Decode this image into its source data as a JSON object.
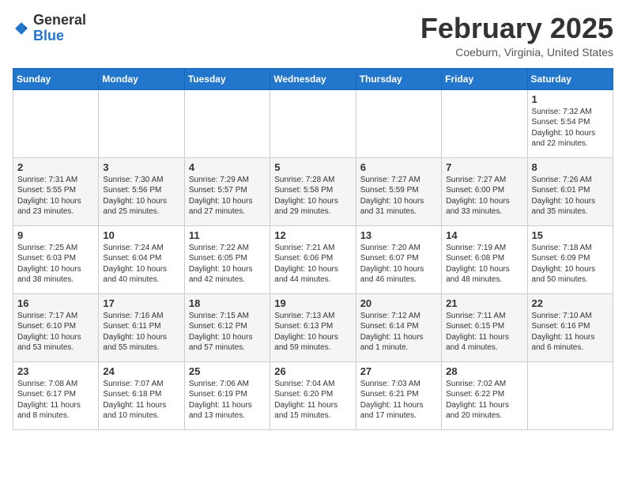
{
  "header": {
    "logo_general": "General",
    "logo_blue": "Blue",
    "title": "February 2025",
    "subtitle": "Coeburn, Virginia, United States"
  },
  "days_of_week": [
    "Sunday",
    "Monday",
    "Tuesday",
    "Wednesday",
    "Thursday",
    "Friday",
    "Saturday"
  ],
  "weeks": [
    [
      {
        "day": "",
        "info": ""
      },
      {
        "day": "",
        "info": ""
      },
      {
        "day": "",
        "info": ""
      },
      {
        "day": "",
        "info": ""
      },
      {
        "day": "",
        "info": ""
      },
      {
        "day": "",
        "info": ""
      },
      {
        "day": "1",
        "info": "Sunrise: 7:32 AM\nSunset: 5:54 PM\nDaylight: 10 hours and 22 minutes."
      }
    ],
    [
      {
        "day": "2",
        "info": "Sunrise: 7:31 AM\nSunset: 5:55 PM\nDaylight: 10 hours and 23 minutes."
      },
      {
        "day": "3",
        "info": "Sunrise: 7:30 AM\nSunset: 5:56 PM\nDaylight: 10 hours and 25 minutes."
      },
      {
        "day": "4",
        "info": "Sunrise: 7:29 AM\nSunset: 5:57 PM\nDaylight: 10 hours and 27 minutes."
      },
      {
        "day": "5",
        "info": "Sunrise: 7:28 AM\nSunset: 5:58 PM\nDaylight: 10 hours and 29 minutes."
      },
      {
        "day": "6",
        "info": "Sunrise: 7:27 AM\nSunset: 5:59 PM\nDaylight: 10 hours and 31 minutes."
      },
      {
        "day": "7",
        "info": "Sunrise: 7:27 AM\nSunset: 6:00 PM\nDaylight: 10 hours and 33 minutes."
      },
      {
        "day": "8",
        "info": "Sunrise: 7:26 AM\nSunset: 6:01 PM\nDaylight: 10 hours and 35 minutes."
      }
    ],
    [
      {
        "day": "9",
        "info": "Sunrise: 7:25 AM\nSunset: 6:03 PM\nDaylight: 10 hours and 38 minutes."
      },
      {
        "day": "10",
        "info": "Sunrise: 7:24 AM\nSunset: 6:04 PM\nDaylight: 10 hours and 40 minutes."
      },
      {
        "day": "11",
        "info": "Sunrise: 7:22 AM\nSunset: 6:05 PM\nDaylight: 10 hours and 42 minutes."
      },
      {
        "day": "12",
        "info": "Sunrise: 7:21 AM\nSunset: 6:06 PM\nDaylight: 10 hours and 44 minutes."
      },
      {
        "day": "13",
        "info": "Sunrise: 7:20 AM\nSunset: 6:07 PM\nDaylight: 10 hours and 46 minutes."
      },
      {
        "day": "14",
        "info": "Sunrise: 7:19 AM\nSunset: 6:08 PM\nDaylight: 10 hours and 48 minutes."
      },
      {
        "day": "15",
        "info": "Sunrise: 7:18 AM\nSunset: 6:09 PM\nDaylight: 10 hours and 50 minutes."
      }
    ],
    [
      {
        "day": "16",
        "info": "Sunrise: 7:17 AM\nSunset: 6:10 PM\nDaylight: 10 hours and 53 minutes."
      },
      {
        "day": "17",
        "info": "Sunrise: 7:16 AM\nSunset: 6:11 PM\nDaylight: 10 hours and 55 minutes."
      },
      {
        "day": "18",
        "info": "Sunrise: 7:15 AM\nSunset: 6:12 PM\nDaylight: 10 hours and 57 minutes."
      },
      {
        "day": "19",
        "info": "Sunrise: 7:13 AM\nSunset: 6:13 PM\nDaylight: 10 hours and 59 minutes."
      },
      {
        "day": "20",
        "info": "Sunrise: 7:12 AM\nSunset: 6:14 PM\nDaylight: 11 hours and 1 minute."
      },
      {
        "day": "21",
        "info": "Sunrise: 7:11 AM\nSunset: 6:15 PM\nDaylight: 11 hours and 4 minutes."
      },
      {
        "day": "22",
        "info": "Sunrise: 7:10 AM\nSunset: 6:16 PM\nDaylight: 11 hours and 6 minutes."
      }
    ],
    [
      {
        "day": "23",
        "info": "Sunrise: 7:08 AM\nSunset: 6:17 PM\nDaylight: 11 hours and 8 minutes."
      },
      {
        "day": "24",
        "info": "Sunrise: 7:07 AM\nSunset: 6:18 PM\nDaylight: 11 hours and 10 minutes."
      },
      {
        "day": "25",
        "info": "Sunrise: 7:06 AM\nSunset: 6:19 PM\nDaylight: 11 hours and 13 minutes."
      },
      {
        "day": "26",
        "info": "Sunrise: 7:04 AM\nSunset: 6:20 PM\nDaylight: 11 hours and 15 minutes."
      },
      {
        "day": "27",
        "info": "Sunrise: 7:03 AM\nSunset: 6:21 PM\nDaylight: 11 hours and 17 minutes."
      },
      {
        "day": "28",
        "info": "Sunrise: 7:02 AM\nSunset: 6:22 PM\nDaylight: 11 hours and 20 minutes."
      },
      {
        "day": "",
        "info": ""
      }
    ]
  ]
}
